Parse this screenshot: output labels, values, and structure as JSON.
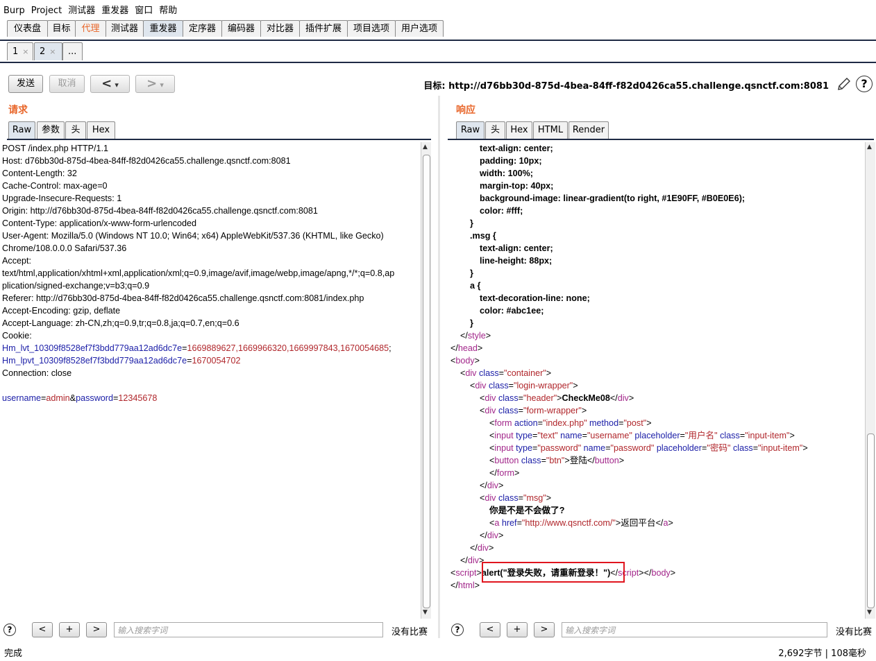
{
  "menubar": [
    "Burp",
    "Project",
    "测试器",
    "重发器",
    "窗口",
    "帮助"
  ],
  "main_tabs": [
    "仪表盘",
    "目标",
    "代理",
    "测试器",
    "重发器",
    "定序器",
    "编码器",
    "对比器",
    "插件扩展",
    "项目选项",
    "用户选项"
  ],
  "sub_tabs": [
    "1",
    "2",
    "..."
  ],
  "toolbar": {
    "send": "发送",
    "cancel": "取消",
    "back": "<",
    "forward": ">",
    "dropdown": "▾"
  },
  "target": {
    "label": "目标:",
    "url": "http://d76bb30d-875d-4bea-84ff-f82d0426ca55.challenge.qsnctf.com:8081"
  },
  "request": {
    "title": "请求",
    "tabs": [
      "Raw",
      "参数",
      "头",
      "Hex"
    ],
    "lines": [
      [
        [
          "k",
          "POST /index.php HTTP/1.1"
        ]
      ],
      [
        [
          "k",
          "Host: d76bb30d-875d-4bea-84ff-f82d0426ca55.challenge.qsnctf.com:8081"
        ]
      ],
      [
        [
          "k",
          "Content-Length: 32"
        ]
      ],
      [
        [
          "k",
          "Cache-Control: max-age=0"
        ]
      ],
      [
        [
          "k",
          "Upgrade-Insecure-Requests: 1"
        ]
      ],
      [
        [
          "k",
          "Origin: http://d76bb30d-875d-4bea-84ff-f82d0426ca55.challenge.qsnctf.com:8081"
        ]
      ],
      [
        [
          "k",
          "Content-Type: application/x-www-form-urlencoded"
        ]
      ],
      [
        [
          "k",
          "User-Agent: Mozilla/5.0 (Windows NT 10.0; Win64; x64) AppleWebKit/537.36 (KHTML, like Gecko)"
        ]
      ],
      [
        [
          "k",
          "Chrome/108.0.0.0 Safari/537.36"
        ]
      ],
      [
        [
          "k",
          "Accept:"
        ]
      ],
      [
        [
          "k",
          "text/html,application/xhtml+xml,application/xml;q=0.9,image/avif,image/webp,image/apng,*/*;q=0.8,ap"
        ]
      ],
      [
        [
          "k",
          "plication/signed-exchange;v=b3;q=0.9"
        ]
      ],
      [
        [
          "k",
          "Referer: http://d76bb30d-875d-4bea-84ff-f82d0426ca55.challenge.qsnctf.com:8081/index.php"
        ]
      ],
      [
        [
          "k",
          "Accept-Encoding: gzip, deflate"
        ]
      ],
      [
        [
          "k",
          "Accept-Language: zh-CN,zh;q=0.9,tr;q=0.8,ja;q=0.7,en;q=0.6"
        ]
      ],
      [
        [
          "k",
          "Cookie:"
        ]
      ],
      [
        [
          "blue",
          "Hm_lvt_10309f8528ef7f3bdd779aa12ad6dc7e"
        ],
        [
          "k",
          "="
        ],
        [
          "red",
          "1669889627,1669966320,1669997843,1670054685"
        ],
        [
          "k",
          ";"
        ]
      ],
      [
        [
          "blue",
          "Hm_lpvt_10309f8528ef7f3bdd779aa12ad6dc7e"
        ],
        [
          "k",
          "="
        ],
        [
          "red",
          "1670054702"
        ]
      ],
      [
        [
          "k",
          "Connection: close"
        ]
      ],
      [
        [
          "k",
          ""
        ]
      ],
      [
        [
          "blue",
          "username"
        ],
        [
          "k",
          "="
        ],
        [
          "red",
          "admin"
        ],
        [
          "k",
          "&"
        ],
        [
          "blue",
          "password"
        ],
        [
          "k",
          "="
        ],
        [
          "red",
          "12345678"
        ]
      ]
    ],
    "search_placeholder": "输入搜索字词",
    "no_match": "没有比赛"
  },
  "response": {
    "title": "响应",
    "tabs": [
      "Raw",
      "头",
      "Hex",
      "HTML",
      "Render"
    ],
    "lines": [
      [
        [
          "k",
          "            "
        ],
        [
          "bold",
          "text-align: center;"
        ]
      ],
      [
        [
          "k",
          "            "
        ],
        [
          "bold",
          "padding: 10px;"
        ]
      ],
      [
        [
          "k",
          "            "
        ],
        [
          "bold",
          "width: 100%;"
        ]
      ],
      [
        [
          "k",
          "            "
        ],
        [
          "bold",
          "margin-top: 40px;"
        ]
      ],
      [
        [
          "k",
          "            "
        ],
        [
          "bold",
          "background-image: linear-gradient(to right, #1E90FF, #B0E0E6);"
        ]
      ],
      [
        [
          "k",
          "            "
        ],
        [
          "bold",
          "color: #fff;"
        ]
      ],
      [
        [
          "k",
          "        "
        ],
        [
          "bold",
          "}"
        ]
      ],
      [
        [
          "k",
          "        "
        ],
        [
          "bold",
          ".msg {"
        ]
      ],
      [
        [
          "k",
          "            "
        ],
        [
          "bold",
          "text-align: center;"
        ]
      ],
      [
        [
          "k",
          "            "
        ],
        [
          "bold",
          "line-height: 88px;"
        ]
      ],
      [
        [
          "k",
          "        "
        ],
        [
          "bold",
          "}"
        ]
      ],
      [
        [
          "k",
          "        "
        ],
        [
          "bold",
          "a {"
        ]
      ],
      [
        [
          "k",
          "            "
        ],
        [
          "bold",
          "text-decoration-line: none;"
        ]
      ],
      [
        [
          "k",
          "            "
        ],
        [
          "bold",
          "color: #abc1ee;"
        ]
      ],
      [
        [
          "k",
          "        "
        ],
        [
          "bold",
          "}"
        ]
      ],
      [
        [
          "k",
          "    </"
        ],
        [
          "tagc",
          "style"
        ],
        [
          "k",
          ">"
        ]
      ],
      [
        [
          "k",
          "</"
        ],
        [
          "tagc",
          "head"
        ],
        [
          "k",
          ">"
        ]
      ],
      [
        [
          "k",
          "<"
        ],
        [
          "tagc",
          "body"
        ],
        [
          "k",
          ">"
        ]
      ],
      [
        [
          "k",
          "    <"
        ],
        [
          "tagc",
          "div"
        ],
        [
          "attr",
          " class"
        ],
        [
          "k",
          "="
        ],
        [
          "val",
          "\"container\""
        ],
        [
          "k",
          ">"
        ]
      ],
      [
        [
          "k",
          "        <"
        ],
        [
          "tagc",
          "div"
        ],
        [
          "attr",
          " class"
        ],
        [
          "k",
          "="
        ],
        [
          "val",
          "\"login-wrapper\""
        ],
        [
          "k",
          ">"
        ]
      ],
      [
        [
          "k",
          "            <"
        ],
        [
          "tagc",
          "div"
        ],
        [
          "attr",
          " class"
        ],
        [
          "k",
          "="
        ],
        [
          "val",
          "\"header\""
        ],
        [
          "k",
          ">"
        ],
        [
          "bold",
          "CheckMe08"
        ],
        [
          "k",
          "</"
        ],
        [
          "tagc",
          "div"
        ],
        [
          "k",
          ">"
        ]
      ],
      [
        [
          "k",
          "            <"
        ],
        [
          "tagc",
          "div"
        ],
        [
          "attr",
          " class"
        ],
        [
          "k",
          "="
        ],
        [
          "val",
          "\"form-wrapper\""
        ],
        [
          "k",
          ">"
        ]
      ],
      [
        [
          "k",
          "                <"
        ],
        [
          "tagc",
          "form"
        ],
        [
          "attr",
          " action"
        ],
        [
          "k",
          "="
        ],
        [
          "val",
          "\"index.php\""
        ],
        [
          "attr",
          " method"
        ],
        [
          "k",
          "="
        ],
        [
          "val",
          "\"post\""
        ],
        [
          "k",
          ">"
        ]
      ],
      [
        [
          "k",
          "                <"
        ],
        [
          "tagc",
          "input"
        ],
        [
          "attr",
          " type"
        ],
        [
          "k",
          "="
        ],
        [
          "val",
          "\"text\""
        ],
        [
          "attr",
          " name"
        ],
        [
          "k",
          "="
        ],
        [
          "val",
          "\"username\""
        ],
        [
          "attr",
          " placeholder"
        ],
        [
          "k",
          "="
        ],
        [
          "val",
          "\"用户名\""
        ],
        [
          "attr",
          " class"
        ],
        [
          "k",
          "="
        ],
        [
          "val",
          "\"input-item\""
        ],
        [
          "k",
          ">"
        ]
      ],
      [
        [
          "k",
          "                <"
        ],
        [
          "tagc",
          "input"
        ],
        [
          "attr",
          " type"
        ],
        [
          "k",
          "="
        ],
        [
          "val",
          "\"password\""
        ],
        [
          "attr",
          " name"
        ],
        [
          "k",
          "="
        ],
        [
          "val",
          "\"password\""
        ],
        [
          "attr",
          " placeholder"
        ],
        [
          "k",
          "="
        ],
        [
          "val",
          "\"密码\""
        ],
        [
          "attr",
          " class"
        ],
        [
          "k",
          "="
        ],
        [
          "val",
          "\"input-item\""
        ],
        [
          "k",
          ">"
        ]
      ],
      [
        [
          "k",
          "                <"
        ],
        [
          "tagc",
          "button"
        ],
        [
          "attr",
          " class"
        ],
        [
          "k",
          "="
        ],
        [
          "val",
          "\"btn\""
        ],
        [
          "k",
          ">登陆</"
        ],
        [
          "tagc",
          "button"
        ],
        [
          "k",
          ">"
        ]
      ],
      [
        [
          "k",
          "                </"
        ],
        [
          "tagc",
          "form"
        ],
        [
          "k",
          ">"
        ]
      ],
      [
        [
          "k",
          "            </"
        ],
        [
          "tagc",
          "div"
        ],
        [
          "k",
          ">"
        ]
      ],
      [
        [
          "k",
          "            <"
        ],
        [
          "tagc",
          "div"
        ],
        [
          "attr",
          " class"
        ],
        [
          "k",
          "="
        ],
        [
          "val",
          "\"msg\""
        ],
        [
          "k",
          ">"
        ]
      ],
      [
        [
          "k",
          "                "
        ],
        [
          "bold",
          "你是不是不会做了?"
        ]
      ],
      [
        [
          "k",
          "                <"
        ],
        [
          "tagc",
          "a"
        ],
        [
          "attr",
          " href"
        ],
        [
          "k",
          "="
        ],
        [
          "val",
          "\"http://www.qsnctf.com/\""
        ],
        [
          "k",
          ">返回平台</"
        ],
        [
          "tagc",
          "a"
        ],
        [
          "k",
          ">"
        ]
      ],
      [
        [
          "k",
          "            </"
        ],
        [
          "tagc",
          "div"
        ],
        [
          "k",
          ">"
        ]
      ],
      [
        [
          "k",
          "        </"
        ],
        [
          "tagc",
          "div"
        ],
        [
          "k",
          ">"
        ]
      ],
      [
        [
          "k",
          "    </"
        ],
        [
          "tagc",
          "div"
        ],
        [
          "k",
          ">"
        ]
      ],
      [
        [
          "k",
          "<"
        ],
        [
          "tagc",
          "script"
        ],
        [
          "k",
          ">"
        ],
        [
          "bold",
          "alert(\"登录失败，请重新登录！\")"
        ],
        [
          "k",
          "</"
        ],
        [
          "tagc",
          "script"
        ],
        [
          "k",
          "></"
        ],
        [
          "tagc",
          "body"
        ],
        [
          "k",
          ">"
        ]
      ],
      [
        [
          "k",
          "</"
        ],
        [
          "tagc",
          "html"
        ],
        [
          "k",
          ">"
        ]
      ]
    ],
    "search_placeholder": "输入搜索字词",
    "no_match": "没有比赛"
  },
  "search_buttons": {
    "prev": "<",
    "add": "+",
    "next": ">",
    "help": "?"
  },
  "status": {
    "left": "完成",
    "right": "2,692字节 | 108毫秒"
  }
}
